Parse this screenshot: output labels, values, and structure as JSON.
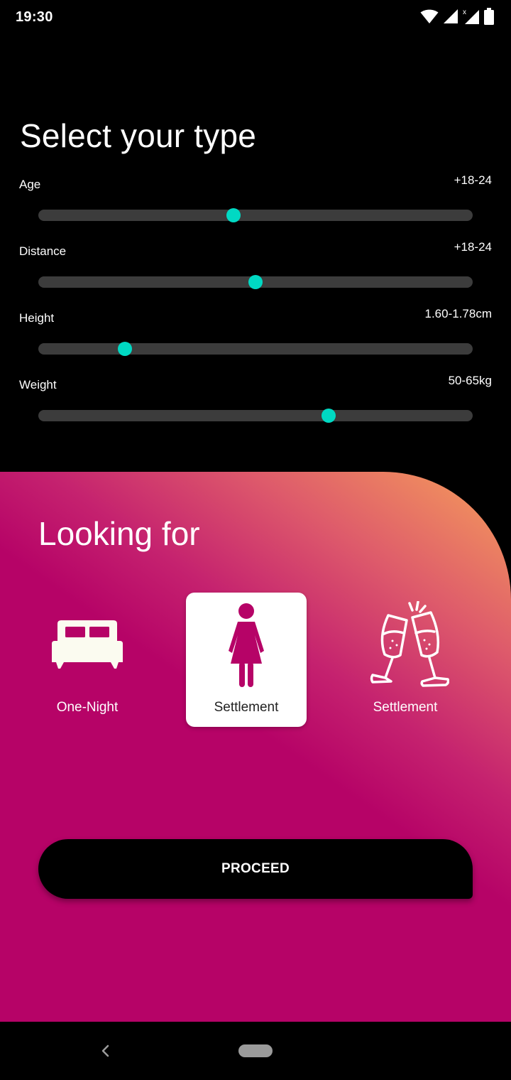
{
  "status_bar": {
    "time": "19:30",
    "icons": [
      "wifi-icon",
      "signal-icon",
      "signal-no-data-icon",
      "battery-icon"
    ]
  },
  "page_title": "Select your type",
  "sliders": [
    {
      "label": "Age",
      "value": "+18-24",
      "position": 0.449
    },
    {
      "label": "Distance",
      "value": "+18-24",
      "position": 0.5
    },
    {
      "label": "Height",
      "value": "1.60-1.78cm",
      "position": 0.2
    },
    {
      "label": "Weight",
      "value": "50-65kg",
      "position": 0.668
    }
  ],
  "looking_for": {
    "title": "Looking for",
    "options": [
      {
        "label": "One-Night",
        "icon": "bed-icon",
        "selected": false
      },
      {
        "label": "Settlement",
        "icon": "woman-icon",
        "selected": true
      },
      {
        "label": "Settlement",
        "icon": "champagne-toast-icon",
        "selected": false
      }
    ]
  },
  "proceed_label": "PROCEED",
  "colors": {
    "accent_thumb": "#00d9c3",
    "track": "#3c3c3c",
    "panel_magenta": "#b60367",
    "panel_orange": "#f6a05a"
  },
  "nav_bar": {
    "icons": [
      "back-icon",
      "home-pill-icon"
    ]
  }
}
